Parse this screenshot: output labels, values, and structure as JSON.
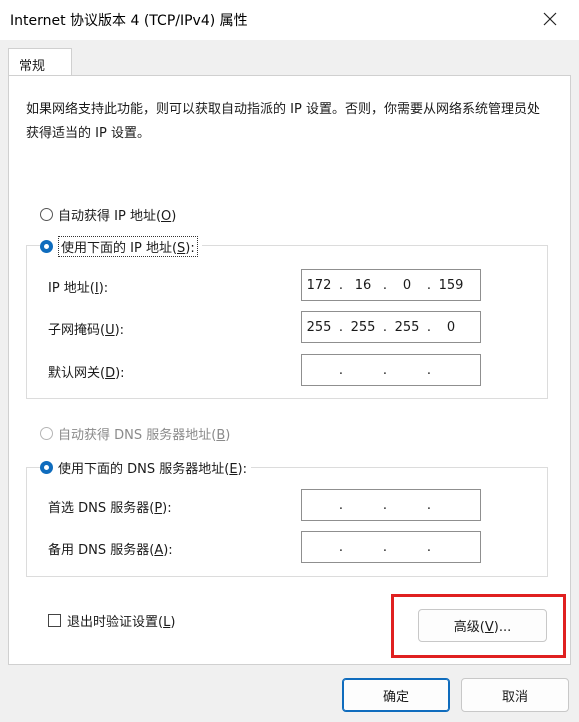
{
  "window": {
    "title": "Internet 协议版本 4 (TCP/IPv4) 属性"
  },
  "tabs": [
    {
      "label": "常规"
    }
  ],
  "description": "如果网络支持此功能，则可以获取自动指派的 IP 设置。否则，你需要从网络系统管理员处获得适当的 IP 设置。",
  "ip": {
    "auto_label": "自动获得 IP 地址(",
    "auto_key": "O",
    "auto_tail": ")",
    "manual_label": "使用下面的 IP 地址(",
    "manual_key": "S",
    "manual_tail": "):",
    "fields": [
      {
        "label": "IP 地址(",
        "key": "I",
        "tail": "):",
        "octets": [
          "172",
          "16",
          "0",
          "159"
        ]
      },
      {
        "label": "子网掩码(",
        "key": "U",
        "tail": "):",
        "octets": [
          "255",
          "255",
          "255",
          "0"
        ]
      },
      {
        "label": "默认网关(",
        "key": "D",
        "tail": "):",
        "octets": [
          "",
          "",
          "",
          ""
        ]
      }
    ]
  },
  "dns": {
    "auto_label": "自动获得 DNS 服务器地址(",
    "auto_key": "B",
    "auto_tail": ")",
    "manual_label": "使用下面的 DNS 服务器地址(",
    "manual_key": "E",
    "manual_tail": "):",
    "fields": [
      {
        "label": "首选 DNS 服务器(",
        "key": "P",
        "tail": "):",
        "octets": [
          "",
          "",
          "",
          ""
        ]
      },
      {
        "label": "备用 DNS 服务器(",
        "key": "A",
        "tail": "):",
        "octets": [
          "",
          "",
          "",
          ""
        ]
      }
    ]
  },
  "validate": {
    "label": "退出时验证设置(",
    "key": "L",
    "tail": ")"
  },
  "advanced": {
    "label": "高级(",
    "key": "V",
    "tail": ")..."
  },
  "buttons": {
    "ok": "确定",
    "cancel": "取消"
  },
  "colors": {
    "accent": "#0f6cbd",
    "highlight": "#e02020"
  }
}
